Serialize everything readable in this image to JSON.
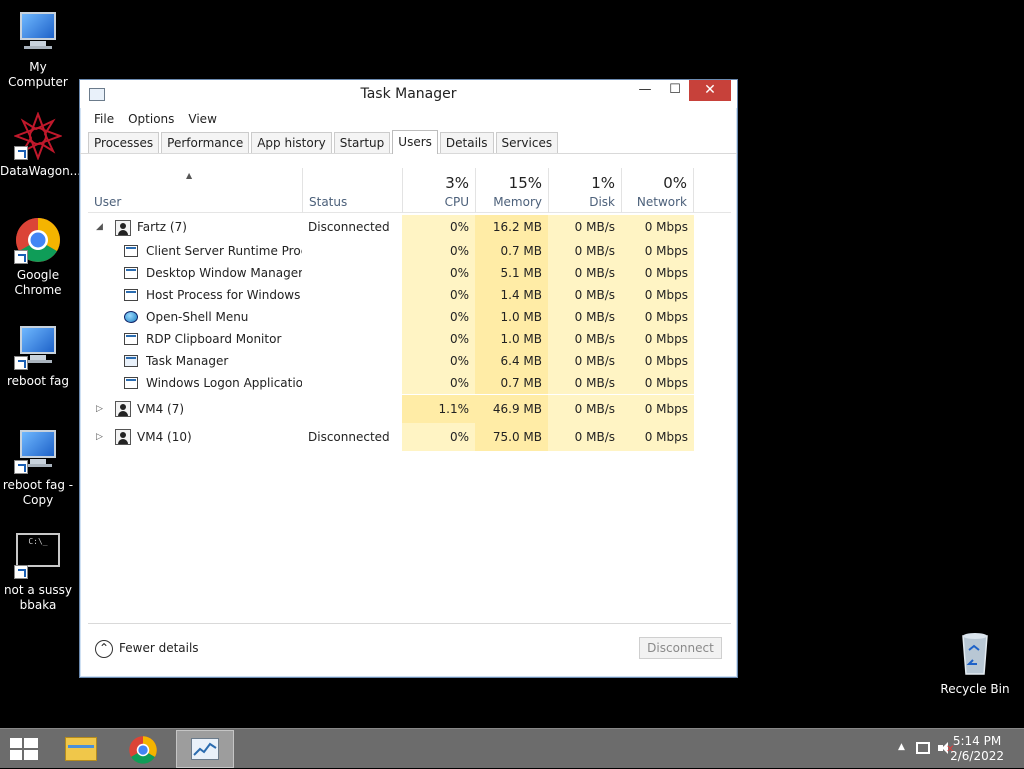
{
  "desktop": {
    "icons": [
      {
        "label": "My Computer",
        "icon": "computer-icon"
      },
      {
        "label": "DataWagon...",
        "icon": "datawagon-icon"
      },
      {
        "label": "Google Chrome",
        "icon": "chrome-icon"
      },
      {
        "label": "reboot fag",
        "icon": "computer-icon"
      },
      {
        "label": "reboot fag - Copy",
        "icon": "computer-icon"
      },
      {
        "label": "not a sussy bbaka",
        "icon": "cmd-icon"
      },
      {
        "label": "Recycle Bin",
        "icon": "recycle-bin-icon"
      }
    ]
  },
  "window": {
    "title": "Task Manager",
    "controls": {
      "minimize": "—",
      "maximize": "☐",
      "close": "✕"
    },
    "menu": [
      "File",
      "Options",
      "View"
    ],
    "tabs": [
      "Processes",
      "Performance",
      "App history",
      "Startup",
      "Users",
      "Details",
      "Services"
    ],
    "active_tab": "Users",
    "columns": {
      "user": {
        "label": "User"
      },
      "status": {
        "label": "Status"
      },
      "cpu": {
        "label": "CPU",
        "percent": "3%"
      },
      "memory": {
        "label": "Memory",
        "percent": "15%"
      },
      "disk": {
        "label": "Disk",
        "percent": "1%"
      },
      "network": {
        "label": "Network",
        "percent": "0%"
      }
    },
    "rows": [
      {
        "kind": "user",
        "expanded": true,
        "name": "Fartz (7)",
        "status": "Disconnected",
        "cpu": "0%",
        "memory": "16.2 MB",
        "disk": "0 MB/s",
        "network": "0 Mbps"
      },
      {
        "kind": "process",
        "icon": "app-window-icon",
        "name": "Client Server Runtime Proc...",
        "status": "",
        "cpu": "0%",
        "memory": "0.7 MB",
        "disk": "0 MB/s",
        "network": "0 Mbps"
      },
      {
        "kind": "process",
        "icon": "app-window-icon",
        "name": "Desktop Window Manager",
        "status": "",
        "cpu": "0%",
        "memory": "5.1 MB",
        "disk": "0 MB/s",
        "network": "0 Mbps"
      },
      {
        "kind": "process",
        "icon": "app-window-icon",
        "name": "Host Process for Windows ...",
        "status": "",
        "cpu": "0%",
        "memory": "1.4 MB",
        "disk": "0 MB/s",
        "network": "0 Mbps"
      },
      {
        "kind": "process",
        "icon": "open-shell-icon",
        "name": "Open-Shell Menu",
        "status": "",
        "cpu": "0%",
        "memory": "1.0 MB",
        "disk": "0 MB/s",
        "network": "0 Mbps"
      },
      {
        "kind": "process",
        "icon": "app-window-icon",
        "name": "RDP Clipboard Monitor",
        "status": "",
        "cpu": "0%",
        "memory": "1.0 MB",
        "disk": "0 MB/s",
        "network": "0 Mbps"
      },
      {
        "kind": "process",
        "icon": "task-manager-icon",
        "name": "Task Manager",
        "status": "",
        "cpu": "0%",
        "memory": "6.4 MB",
        "disk": "0 MB/s",
        "network": "0 Mbps"
      },
      {
        "kind": "process",
        "icon": "app-window-icon",
        "name": "Windows Logon Application",
        "status": "",
        "cpu": "0%",
        "memory": "0.7 MB",
        "disk": "0 MB/s",
        "network": "0 Mbps"
      },
      {
        "kind": "user",
        "expanded": false,
        "name": "VM4 (7)",
        "status": "",
        "cpu": "1.1%",
        "memory": "46.9 MB",
        "disk": "0 MB/s",
        "network": "0 Mbps"
      },
      {
        "kind": "user",
        "expanded": false,
        "name": "VM4 (10)",
        "status": "Disconnected",
        "cpu": "0%",
        "memory": "75.0 MB",
        "disk": "0 MB/s",
        "network": "0 Mbps"
      }
    ],
    "footer": {
      "fewer_details": "Fewer details",
      "disconnect": "Disconnect"
    }
  },
  "taskbar": {
    "items": [
      "file-explorer-icon",
      "chrome-icon",
      "task-manager-icon"
    ],
    "tray": {
      "time": "5:14 PM",
      "date": "2/6/2022"
    }
  },
  "colors": {
    "heat_light": "#fff4c4",
    "heat_medium": "#ffeca6",
    "close_button": "#c7413a",
    "taskbar": "#6c6c6c"
  }
}
